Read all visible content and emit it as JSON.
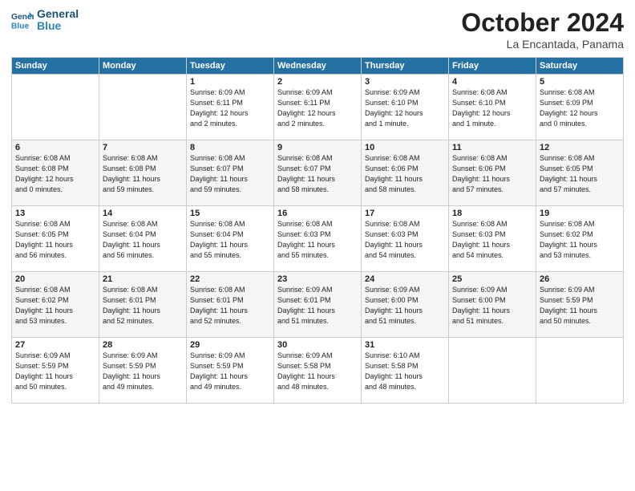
{
  "logo": {
    "line1": "General",
    "line2": "Blue"
  },
  "title": "October 2024",
  "subtitle": "La Encantada, Panama",
  "days_header": [
    "Sunday",
    "Monday",
    "Tuesday",
    "Wednesday",
    "Thursday",
    "Friday",
    "Saturday"
  ],
  "weeks": [
    [
      {
        "day": "",
        "info": ""
      },
      {
        "day": "",
        "info": ""
      },
      {
        "day": "1",
        "info": "Sunrise: 6:09 AM\nSunset: 6:11 PM\nDaylight: 12 hours\nand 2 minutes."
      },
      {
        "day": "2",
        "info": "Sunrise: 6:09 AM\nSunset: 6:11 PM\nDaylight: 12 hours\nand 2 minutes."
      },
      {
        "day": "3",
        "info": "Sunrise: 6:09 AM\nSunset: 6:10 PM\nDaylight: 12 hours\nand 1 minute."
      },
      {
        "day": "4",
        "info": "Sunrise: 6:08 AM\nSunset: 6:10 PM\nDaylight: 12 hours\nand 1 minute."
      },
      {
        "day": "5",
        "info": "Sunrise: 6:08 AM\nSunset: 6:09 PM\nDaylight: 12 hours\nand 0 minutes."
      }
    ],
    [
      {
        "day": "6",
        "info": "Sunrise: 6:08 AM\nSunset: 6:08 PM\nDaylight: 12 hours\nand 0 minutes."
      },
      {
        "day": "7",
        "info": "Sunrise: 6:08 AM\nSunset: 6:08 PM\nDaylight: 11 hours\nand 59 minutes."
      },
      {
        "day": "8",
        "info": "Sunrise: 6:08 AM\nSunset: 6:07 PM\nDaylight: 11 hours\nand 59 minutes."
      },
      {
        "day": "9",
        "info": "Sunrise: 6:08 AM\nSunset: 6:07 PM\nDaylight: 11 hours\nand 58 minutes."
      },
      {
        "day": "10",
        "info": "Sunrise: 6:08 AM\nSunset: 6:06 PM\nDaylight: 11 hours\nand 58 minutes."
      },
      {
        "day": "11",
        "info": "Sunrise: 6:08 AM\nSunset: 6:06 PM\nDaylight: 11 hours\nand 57 minutes."
      },
      {
        "day": "12",
        "info": "Sunrise: 6:08 AM\nSunset: 6:05 PM\nDaylight: 11 hours\nand 57 minutes."
      }
    ],
    [
      {
        "day": "13",
        "info": "Sunrise: 6:08 AM\nSunset: 6:05 PM\nDaylight: 11 hours\nand 56 minutes."
      },
      {
        "day": "14",
        "info": "Sunrise: 6:08 AM\nSunset: 6:04 PM\nDaylight: 11 hours\nand 56 minutes."
      },
      {
        "day": "15",
        "info": "Sunrise: 6:08 AM\nSunset: 6:04 PM\nDaylight: 11 hours\nand 55 minutes."
      },
      {
        "day": "16",
        "info": "Sunrise: 6:08 AM\nSunset: 6:03 PM\nDaylight: 11 hours\nand 55 minutes."
      },
      {
        "day": "17",
        "info": "Sunrise: 6:08 AM\nSunset: 6:03 PM\nDaylight: 11 hours\nand 54 minutes."
      },
      {
        "day": "18",
        "info": "Sunrise: 6:08 AM\nSunset: 6:03 PM\nDaylight: 11 hours\nand 54 minutes."
      },
      {
        "day": "19",
        "info": "Sunrise: 6:08 AM\nSunset: 6:02 PM\nDaylight: 11 hours\nand 53 minutes."
      }
    ],
    [
      {
        "day": "20",
        "info": "Sunrise: 6:08 AM\nSunset: 6:02 PM\nDaylight: 11 hours\nand 53 minutes."
      },
      {
        "day": "21",
        "info": "Sunrise: 6:08 AM\nSunset: 6:01 PM\nDaylight: 11 hours\nand 52 minutes."
      },
      {
        "day": "22",
        "info": "Sunrise: 6:08 AM\nSunset: 6:01 PM\nDaylight: 11 hours\nand 52 minutes."
      },
      {
        "day": "23",
        "info": "Sunrise: 6:09 AM\nSunset: 6:01 PM\nDaylight: 11 hours\nand 51 minutes."
      },
      {
        "day": "24",
        "info": "Sunrise: 6:09 AM\nSunset: 6:00 PM\nDaylight: 11 hours\nand 51 minutes."
      },
      {
        "day": "25",
        "info": "Sunrise: 6:09 AM\nSunset: 6:00 PM\nDaylight: 11 hours\nand 51 minutes."
      },
      {
        "day": "26",
        "info": "Sunrise: 6:09 AM\nSunset: 5:59 PM\nDaylight: 11 hours\nand 50 minutes."
      }
    ],
    [
      {
        "day": "27",
        "info": "Sunrise: 6:09 AM\nSunset: 5:59 PM\nDaylight: 11 hours\nand 50 minutes."
      },
      {
        "day": "28",
        "info": "Sunrise: 6:09 AM\nSunset: 5:59 PM\nDaylight: 11 hours\nand 49 minutes."
      },
      {
        "day": "29",
        "info": "Sunrise: 6:09 AM\nSunset: 5:59 PM\nDaylight: 11 hours\nand 49 minutes."
      },
      {
        "day": "30",
        "info": "Sunrise: 6:09 AM\nSunset: 5:58 PM\nDaylight: 11 hours\nand 48 minutes."
      },
      {
        "day": "31",
        "info": "Sunrise: 6:10 AM\nSunset: 5:58 PM\nDaylight: 11 hours\nand 48 minutes."
      },
      {
        "day": "",
        "info": ""
      },
      {
        "day": "",
        "info": ""
      }
    ]
  ]
}
